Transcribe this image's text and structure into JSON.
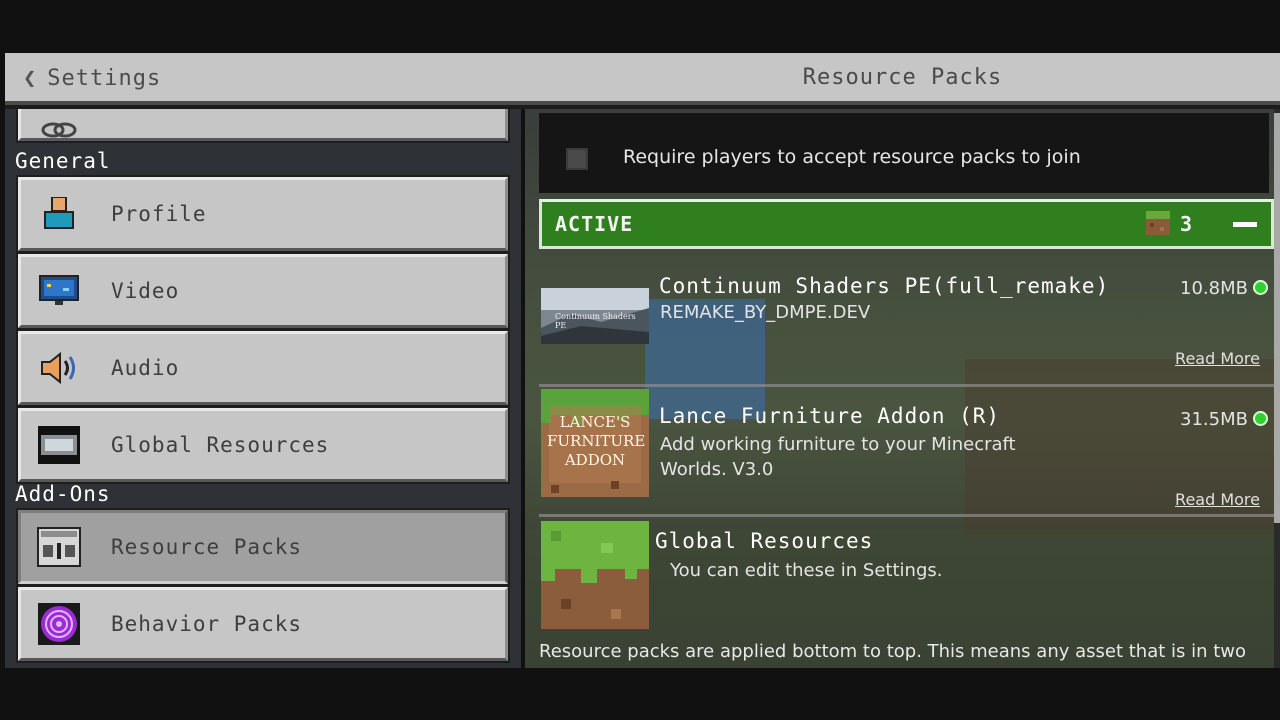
{
  "header": {
    "back_label": "Settings",
    "title": "Resource Packs"
  },
  "sidebar": {
    "sections": [
      {
        "label": "General"
      },
      {
        "label": "Add-Ons"
      }
    ],
    "items": [
      {
        "label": "Profile",
        "icon": "profile-icon"
      },
      {
        "label": "Video",
        "icon": "monitor-icon"
      },
      {
        "label": "Audio",
        "icon": "speaker-icon"
      },
      {
        "label": "Global Resources",
        "icon": "global-resources-icon"
      },
      {
        "label": "Resource Packs",
        "icon": "resource-pack-icon",
        "selected": true
      },
      {
        "label": "Behavior Packs",
        "icon": "behavior-pack-icon"
      }
    ]
  },
  "main": {
    "require_toggle": {
      "label": "Require players to accept resource packs to join",
      "checked": false
    },
    "active_section": {
      "label": "ACTIVE",
      "count": "3",
      "icon": "grass-block-icon"
    },
    "packs": [
      {
        "name": "Continuum Shaders PE(full_remake)",
        "description": "REMAKE_BY_DMPE.DEV",
        "size": "10.8MB",
        "read_more": "Read More",
        "thumb_text": "Continuum Shaders PE"
      },
      {
        "name": "Lance Furniture Addon (R)",
        "description": "Add working furniture to your Minecraft Worlds. V3.0",
        "size": "31.5MB",
        "read_more": "Read More",
        "thumb_text": "LANCE'S FURNITURE ADDON"
      },
      {
        "name": "Global Resources",
        "description": "You can edit these in Settings."
      }
    ],
    "footer_note": "Resource packs are applied bottom to top. This means any asset that is in two"
  },
  "colors": {
    "active_green": "#2f7f1f",
    "status_dot": "#2fd12f",
    "button_gray": "#c6c6c6"
  }
}
